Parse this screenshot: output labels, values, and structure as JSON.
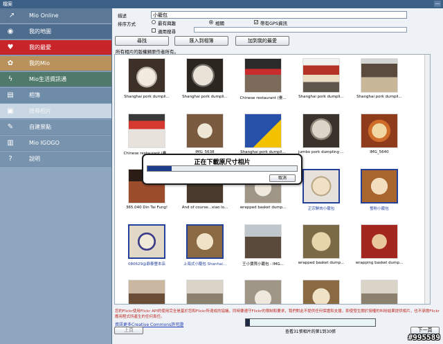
{
  "window": {
    "title": "檔案",
    "minimize": "—"
  },
  "sidebar": {
    "items": [
      {
        "label": "Mio Online",
        "icon": "mio-arrow-logo-icon"
      },
      {
        "label": "我的地圖",
        "icon": "eye-icon"
      },
      {
        "label": "我的最愛",
        "icon": "heart-icon"
      },
      {
        "label": "我的Mio",
        "icon": "gear-icon"
      },
      {
        "label": "Mio生活資訊通",
        "icon": "lightning-icon"
      },
      {
        "label": "相簿",
        "icon": "photo-album-icon"
      },
      {
        "label": "搜尋相片",
        "icon": "photo-search-icon"
      },
      {
        "label": "自建景點",
        "icon": "edit-poi-icon"
      },
      {
        "label": "Mio IGOGO",
        "icon": "book-icon"
      },
      {
        "label": "說明",
        "icon": "question-icon"
      }
    ],
    "glyphs": [
      "↗",
      "◉",
      "♥",
      "✿",
      "ϟ",
      "▤",
      "▣",
      "✎",
      "▥",
      "?"
    ]
  },
  "search": {
    "keyword_label": "描述",
    "keyword_value": "小籠包",
    "sort_label": "排序方式",
    "sort_options": [
      "最有興趣",
      "相關"
    ],
    "sort_selected": 1,
    "gps_label": "帶有GPS資訊",
    "gps_checked": true,
    "slider_check_label": "適用搜尋",
    "slider_checked": false
  },
  "buttons": {
    "search": "尋找",
    "import": "匯入到相簿",
    "add_fav": "加到我的最愛"
  },
  "hint": "所有相片的版權歸原作者所有。",
  "photos": [
    {
      "caption": "Shanghai pork dumpli...",
      "style": "t1",
      "selected": false
    },
    {
      "caption": "Shanghai pork dumpli...",
      "style": "t2",
      "selected": false
    },
    {
      "caption": "Chinese restaurant (臺...",
      "style": "t3",
      "selected": false
    },
    {
      "caption": "Shanghai pork dumpli...",
      "style": "t4",
      "selected": false
    },
    {
      "caption": "Shanghai pork dumpli...",
      "style": "t5",
      "selected": false
    },
    {
      "caption": "Chinese restaurant (臺...",
      "style": "t6",
      "selected": false
    },
    {
      "caption": "IMG_5638",
      "style": "t7",
      "selected": false
    },
    {
      "caption": "Shanghai pork dumpli...",
      "style": "t8",
      "selected": false
    },
    {
      "caption": "jumbo pork dumpling ...",
      "style": "t9",
      "selected": false
    },
    {
      "caption": "IMG_5640",
      "style": "t10",
      "selected": false
    },
    {
      "caption": "365.040 Din Tai Fung!",
      "style": "t11",
      "selected": false
    },
    {
      "caption": "And of course...xiao lo...",
      "style": "t12",
      "selected": false
    },
    {
      "caption": "wrapped basket dump...",
      "style": "t13",
      "selected": false
    },
    {
      "caption": "正宗鮮肉小籠包",
      "style": "t14",
      "selected": true
    },
    {
      "caption": "蟹粉小籠包",
      "style": "t15",
      "selected": true
    },
    {
      "caption": "080629@鼎泰豐本店",
      "style": "t16",
      "selected": true
    },
    {
      "caption": "上海式小籠包 Shanhai...",
      "style": "t17",
      "selected": true
    },
    {
      "caption": "王小寶買小籠包 - IMG...",
      "style": "t18",
      "selected": false
    },
    {
      "caption": "wrapped basket dump...",
      "style": "t19",
      "selected": false
    },
    {
      "caption": "wrapping basket dump...",
      "style": "t20",
      "selected": false
    },
    {
      "caption": "",
      "style": "t21",
      "selected": false
    },
    {
      "caption": "",
      "style": "t22",
      "selected": false
    },
    {
      "caption": "",
      "style": "t13",
      "selected": false
    },
    {
      "caption": "",
      "style": "t17",
      "selected": false
    },
    {
      "caption": "",
      "style": "t22",
      "selected": false
    }
  ],
  "dialog": {
    "title": "正在下載原尺寸相片",
    "progress_fraction": 0.16,
    "cancel": "取消"
  },
  "footer": {
    "disclaimer": "您的Flickr使用Flickr API的使用完全是基於您和Flickr所達成的協議，同時要遵守Flickr的限制和要求，我們對此不提供任何保證和支援，即使發生關於授權的糾紛結果提供相片，也不承擔Flickr應用程式所產生的任何責任。",
    "cc_link": "資訊更多Creative Commons許可證",
    "count_text": "查看31張相片的第1到30張",
    "count_fraction": 0.03,
    "prev": "上頁",
    "next": "下一頁"
  },
  "watermark": "#995589"
}
